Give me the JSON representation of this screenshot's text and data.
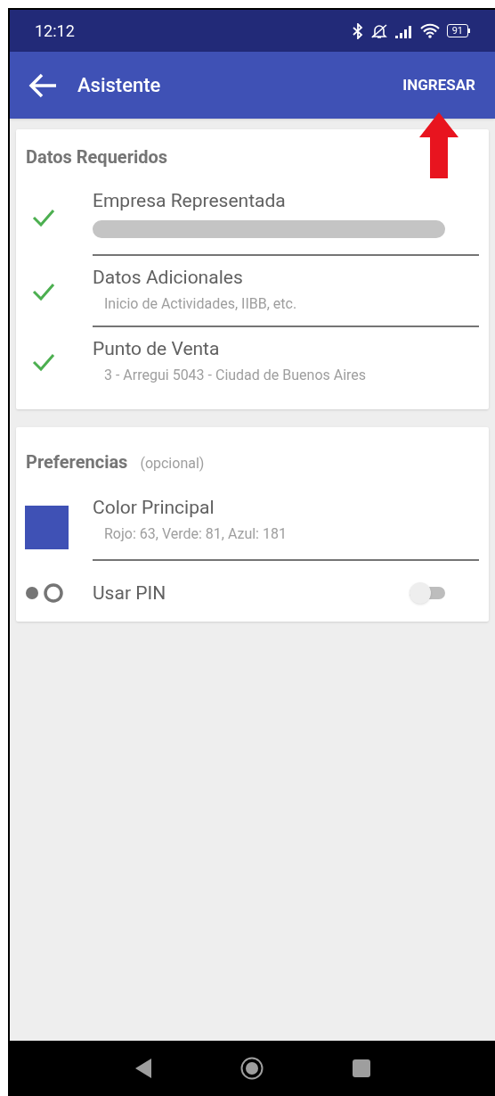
{
  "status_bar": {
    "time": "12:12",
    "battery": "91"
  },
  "app_bar": {
    "title": "Asistente",
    "action": "INGRESAR"
  },
  "annotation": {
    "kind": "arrow"
  },
  "required": {
    "title": "Datos Requeridos",
    "items": [
      {
        "title": "Empresa Representada",
        "redacted": true,
        "checked": true
      },
      {
        "title": "Datos Adicionales",
        "subtitle": "Inicio de Actividades, IIBB, etc.",
        "checked": true
      },
      {
        "title": "Punto de Venta",
        "subtitle": "3 - Arregui 5043 - Ciudad de Buenos Aires",
        "checked": true
      }
    ]
  },
  "preferences": {
    "title": "Preferencias",
    "note": "(opcional)",
    "items": [
      {
        "kind": "color",
        "title": "Color Principal",
        "subtitle": "Rojo: 63, Verde: 81, Azul: 181",
        "color": "#3f51b5"
      },
      {
        "kind": "switch",
        "title": "Usar PIN",
        "on": false
      }
    ]
  }
}
